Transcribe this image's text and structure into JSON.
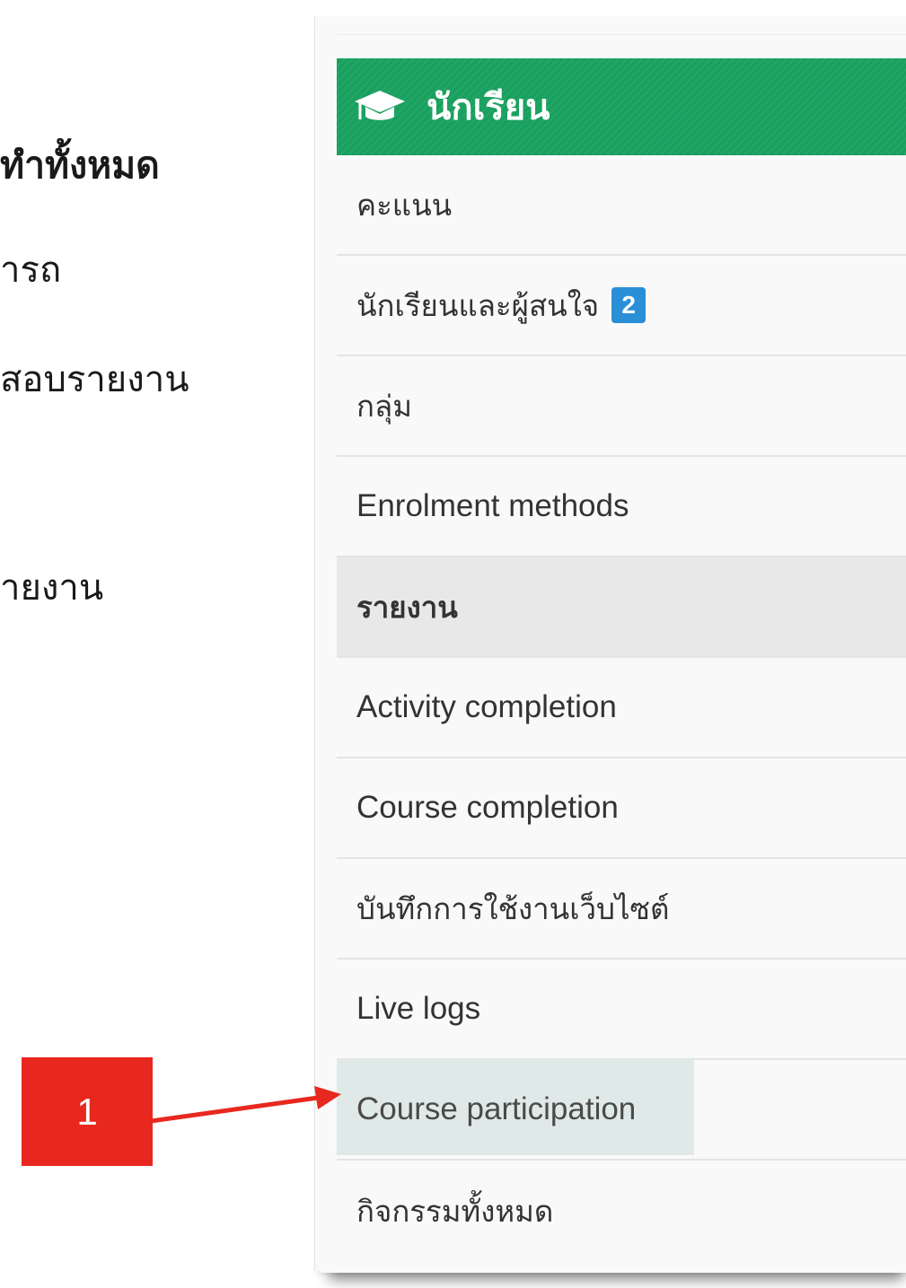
{
  "document": {
    "line1": "ี่ทำทั้งหมด",
    "line2": "ารถ",
    "line3": "สอบรายงาน",
    "line4": "ายงาน"
  },
  "panel": {
    "header": {
      "icon": "graduation-cap-icon",
      "title": "นักเรียน",
      "bg_color": "#19a05f"
    },
    "items": [
      {
        "label": "คะแนน"
      },
      {
        "label": "นักเรียนและผู้สนใจ",
        "badge": "2"
      },
      {
        "label": "กลุ่ม"
      },
      {
        "label": "Enrolment methods"
      },
      {
        "label": "รายงาน"
      },
      {
        "label": "Activity completion"
      },
      {
        "label": "Course completion"
      },
      {
        "label": "บันทึกการใช้งานเว็บไซต์"
      },
      {
        "label": "Live logs"
      },
      {
        "label": "Course participation"
      },
      {
        "label": "กิจกรรมทั้งหมด"
      }
    ]
  },
  "callout": {
    "number": "1",
    "color": "#e8281e"
  }
}
